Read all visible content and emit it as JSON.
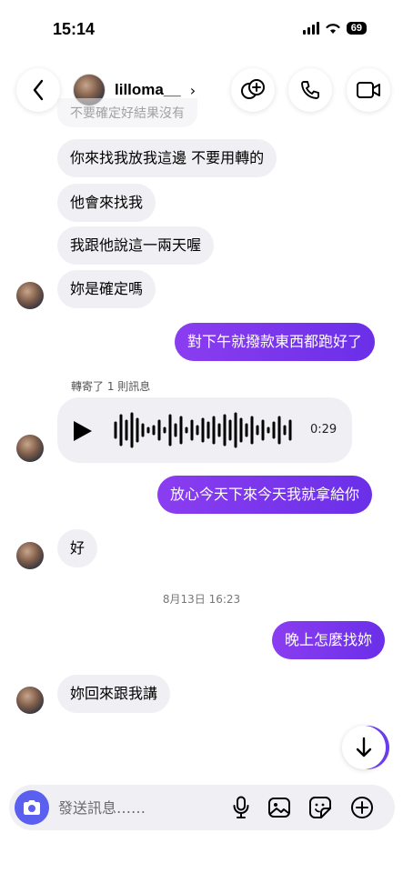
{
  "status": {
    "time": "15:14",
    "battery": "69"
  },
  "header": {
    "username": "lilloma__",
    "chevron": "›"
  },
  "messages": {
    "m0": "不要確定好結果沒有",
    "m1": "你來找我放我這邊 不要用轉的",
    "m2": "他會來找我",
    "m3": "我跟他說這一兩天喔",
    "m4": "妳是確定嗎",
    "m5": "對下午就撥款東西都跑好了",
    "forwarded": "轉寄了 1 則訊息",
    "voice_duration": "0:29",
    "m6": "放心今天下來今天我就拿給你",
    "m7": "好",
    "date": "8月13日 16:23",
    "m8": "晚上怎麼找妳",
    "m9": "妳回來跟我講"
  },
  "composer": {
    "placeholder": "發送訊息……"
  },
  "colors": {
    "outgoing_start": "#8b3df0",
    "outgoing_end": "#6a2fe8",
    "incoming": "#f0f0f4",
    "camera": "#5b5ff0"
  }
}
